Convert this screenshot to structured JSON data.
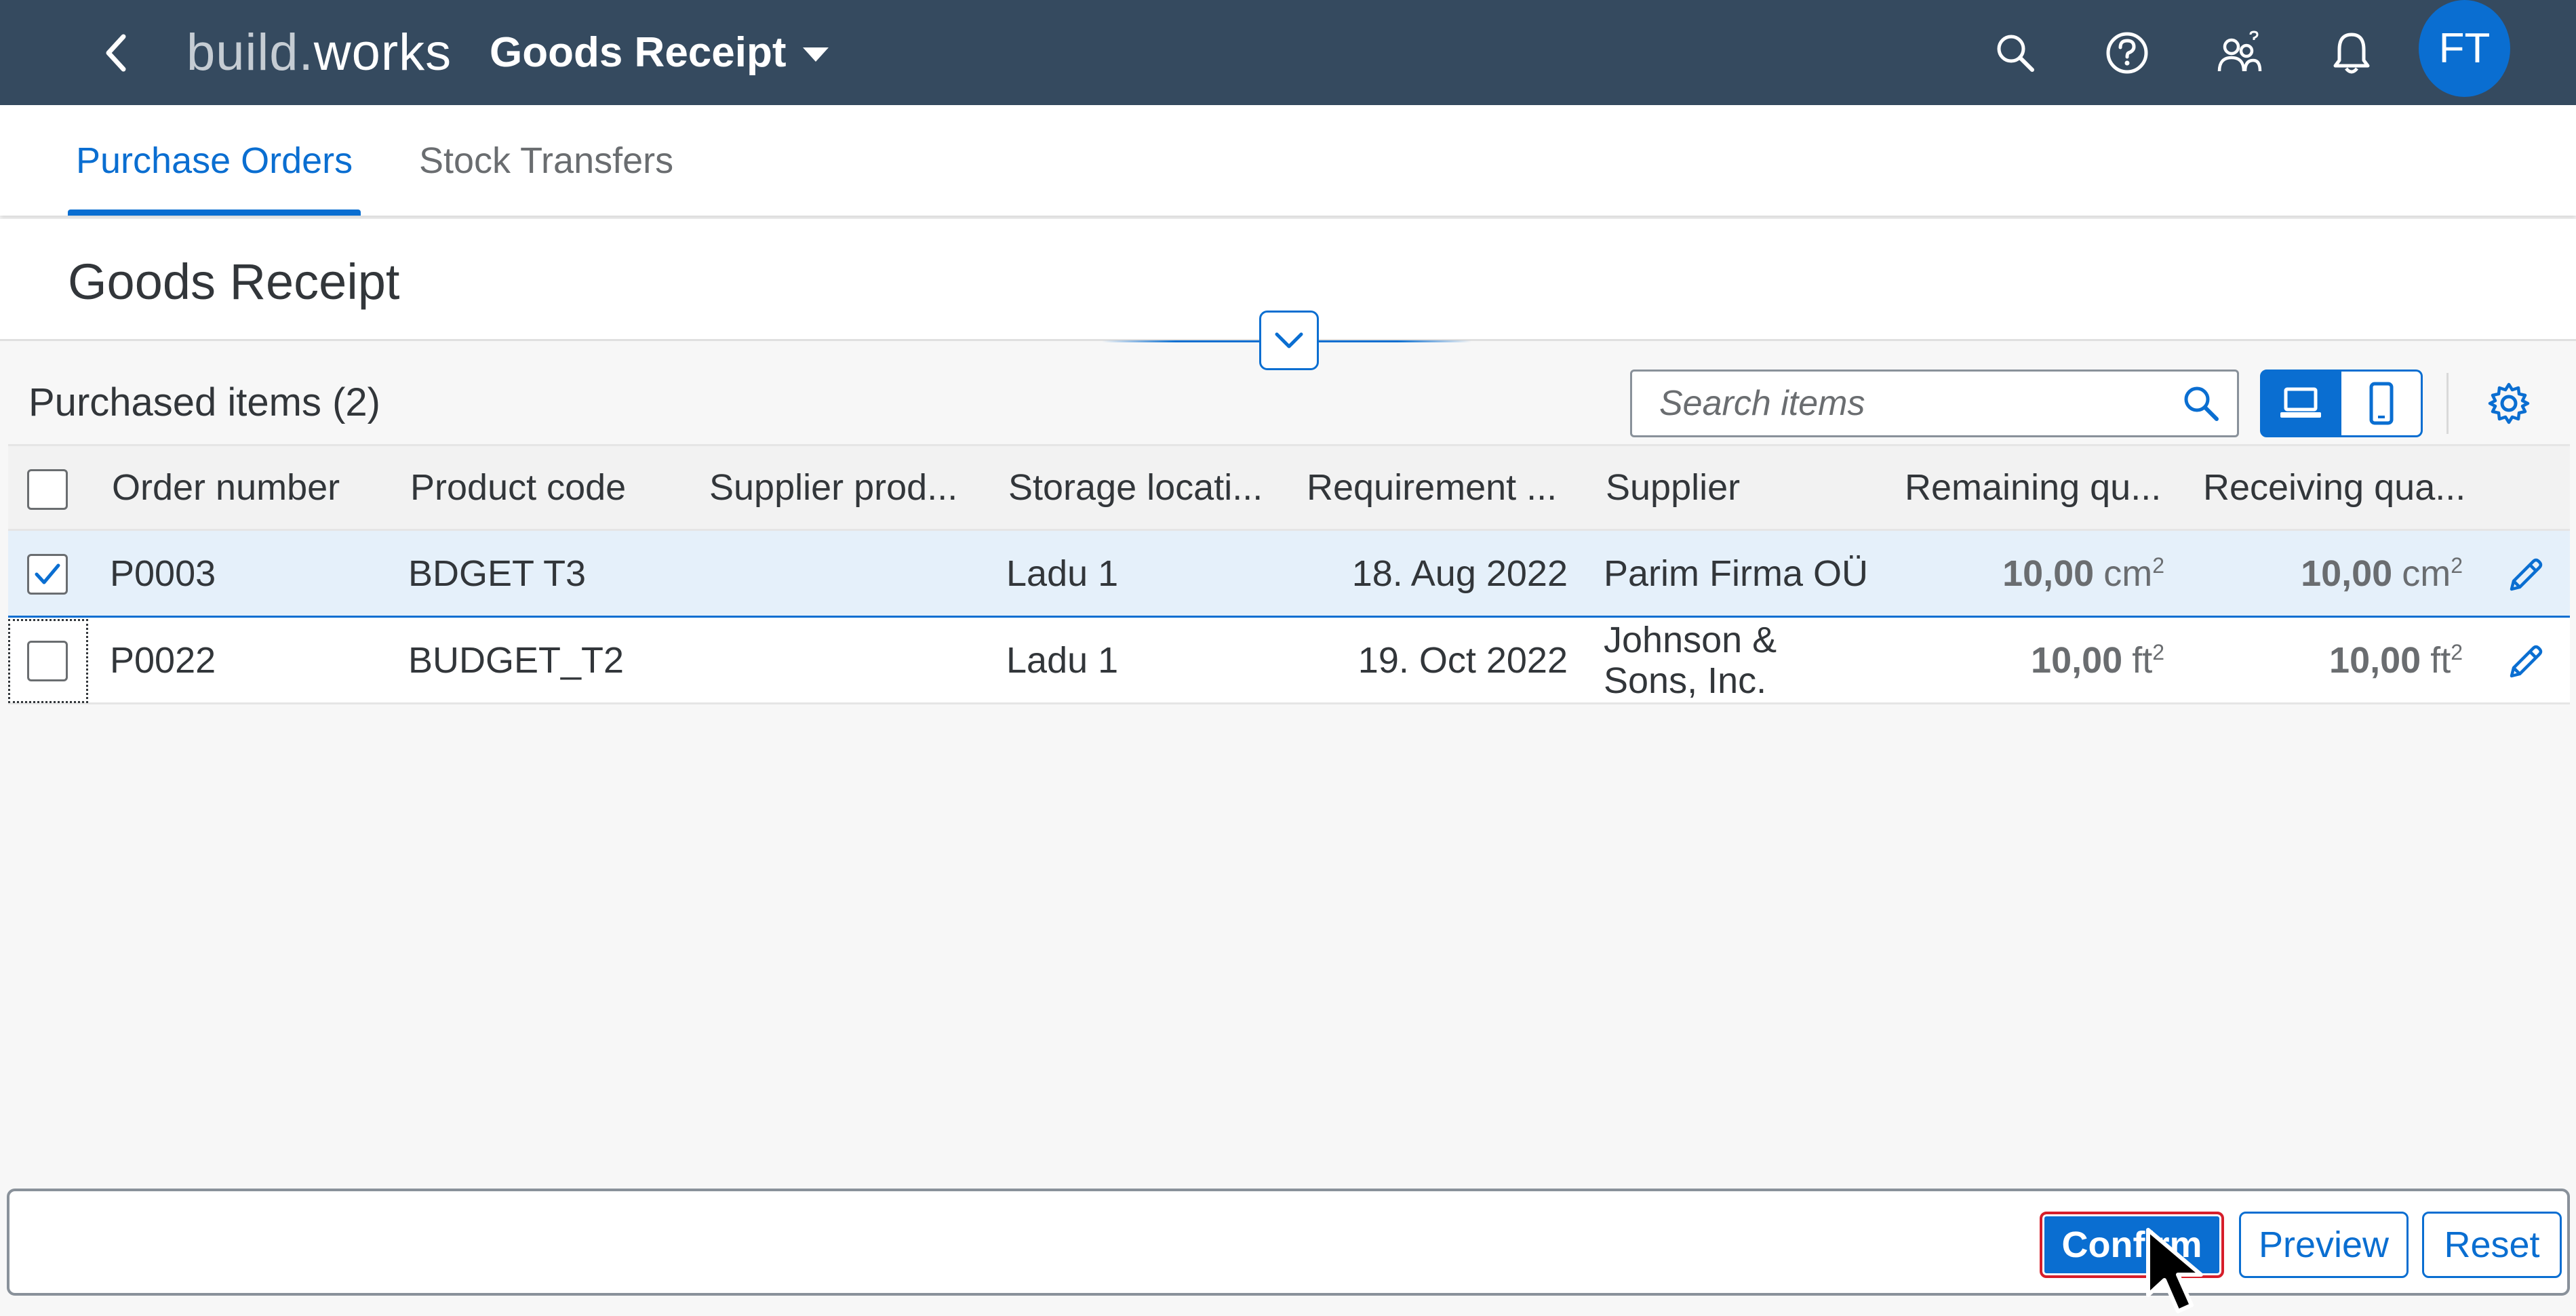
{
  "shell": {
    "logo_part1": "build",
    "logo_dot": ".",
    "logo_part2": "works",
    "app_title": "Goods Receipt",
    "avatar_initials": "FT",
    "accent_color": "#354a5f"
  },
  "tabs": [
    {
      "label": "Purchase Orders",
      "active": true
    },
    {
      "label": "Stock Transfers",
      "active": false
    }
  ],
  "page": {
    "title": "Goods Receipt"
  },
  "table": {
    "heading": "Purchased items (2)",
    "search_placeholder": "Search items",
    "columns": [
      "Order number",
      "Product code",
      "Supplier prod...",
      "Storage locati...",
      "Requirement ...",
      "Supplier",
      "Remaining qu...",
      "Receiving qua..."
    ],
    "rows": [
      {
        "selected": true,
        "order_number": "P0003",
        "product_code": "BDGET T3",
        "supplier_product": "",
        "storage_location": "Ladu 1",
        "requirement_date": "18. Aug 2022",
        "supplier": "Parim Firma OÜ",
        "remaining_qty": "10,00",
        "remaining_unit": "cm",
        "remaining_unit_exp": "2",
        "receiving_qty": "10,00",
        "receiving_unit": "cm",
        "receiving_unit_exp": "2"
      },
      {
        "selected": false,
        "order_number": "P0022",
        "product_code": "BUDGET_T2",
        "supplier_product": "",
        "storage_location": "Ladu 1",
        "requirement_date": "19. Oct 2022",
        "supplier": "Johnson & Sons, Inc.",
        "remaining_qty": "10,00",
        "remaining_unit": "ft",
        "remaining_unit_exp": "2",
        "receiving_qty": "10,00",
        "receiving_unit": "ft",
        "receiving_unit_exp": "2"
      }
    ]
  },
  "footer": {
    "confirm_label": "Confirm",
    "preview_label": "Preview",
    "reset_label": "Reset"
  },
  "icons": {
    "back": "chevron-left-icon",
    "search": "search-icon",
    "help": "help-icon",
    "collaborators": "people-icon",
    "notifications": "bell-icon",
    "collapse": "chevron-down-icon",
    "desktop_view": "laptop-icon",
    "mobile_view": "phone-icon",
    "settings": "gear-icon",
    "edit": "pencil-icon"
  }
}
